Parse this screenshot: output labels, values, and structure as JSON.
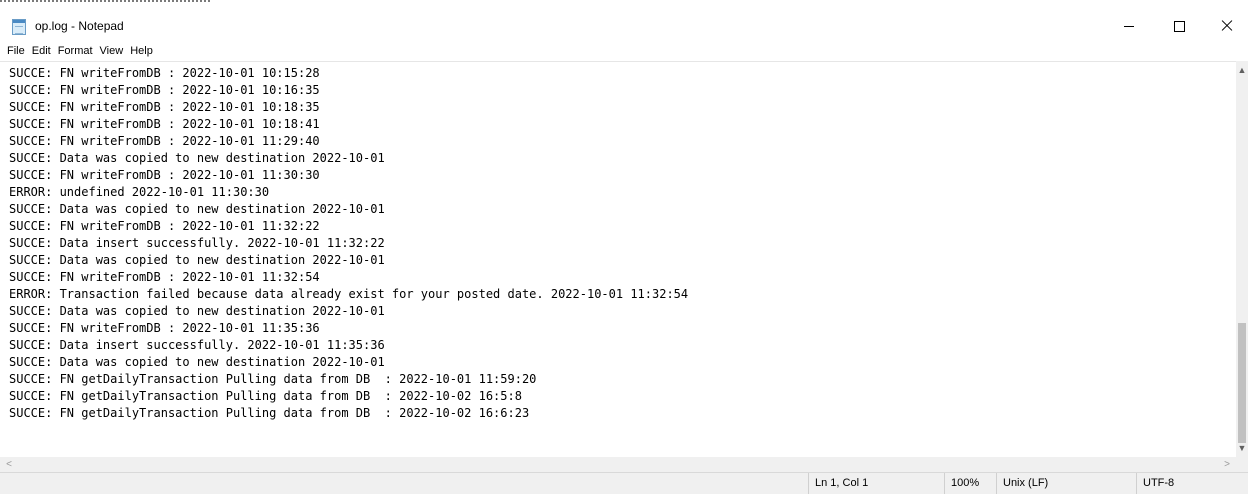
{
  "window": {
    "title": "op.log - Notepad",
    "controls": {
      "minimize": "–",
      "maximize": "□",
      "close": "×"
    }
  },
  "menu": [
    "File",
    "Edit",
    "Format",
    "View",
    "Help"
  ],
  "editor": {
    "lines": [
      "SUCCE: FN writeFromDB : 2022-10-01 10:15:28",
      "SUCCE: FN writeFromDB : 2022-10-01 10:16:35",
      "SUCCE: FN writeFromDB : 2022-10-01 10:18:35",
      "SUCCE: FN writeFromDB : 2022-10-01 10:18:41",
      "SUCCE: FN writeFromDB : 2022-10-01 11:29:40",
      "SUCCE: Data was copied to new destination 2022-10-01",
      "SUCCE: FN writeFromDB : 2022-10-01 11:30:30",
      "ERROR: undefined 2022-10-01 11:30:30",
      "SUCCE: Data was copied to new destination 2022-10-01",
      "SUCCE: FN writeFromDB : 2022-10-01 11:32:22",
      "SUCCE: Data insert successfully. 2022-10-01 11:32:22",
      "SUCCE: Data was copied to new destination 2022-10-01",
      "SUCCE: FN writeFromDB : 2022-10-01 11:32:54",
      "ERROR: Transaction failed because data already exist for your posted date. 2022-10-01 11:32:54",
      "SUCCE: Data was copied to new destination 2022-10-01",
      "SUCCE: FN writeFromDB : 2022-10-01 11:35:36",
      "SUCCE: Data insert successfully. 2022-10-01 11:35:36",
      "SUCCE: Data was copied to new destination 2022-10-01",
      "SUCCE: FN getDailyTransaction Pulling data from DB  : 2022-10-01 11:59:20",
      "SUCCE: FN getDailyTransaction Pulling data from DB  : 2022-10-02 16:5:8",
      "SUCCE: FN getDailyTransaction Pulling data from DB  : 2022-10-02 16:6:23"
    ]
  },
  "status": {
    "position": "Ln 1, Col 1",
    "zoom": "100%",
    "line_ending": "Unix (LF)",
    "encoding": "UTF-8"
  }
}
